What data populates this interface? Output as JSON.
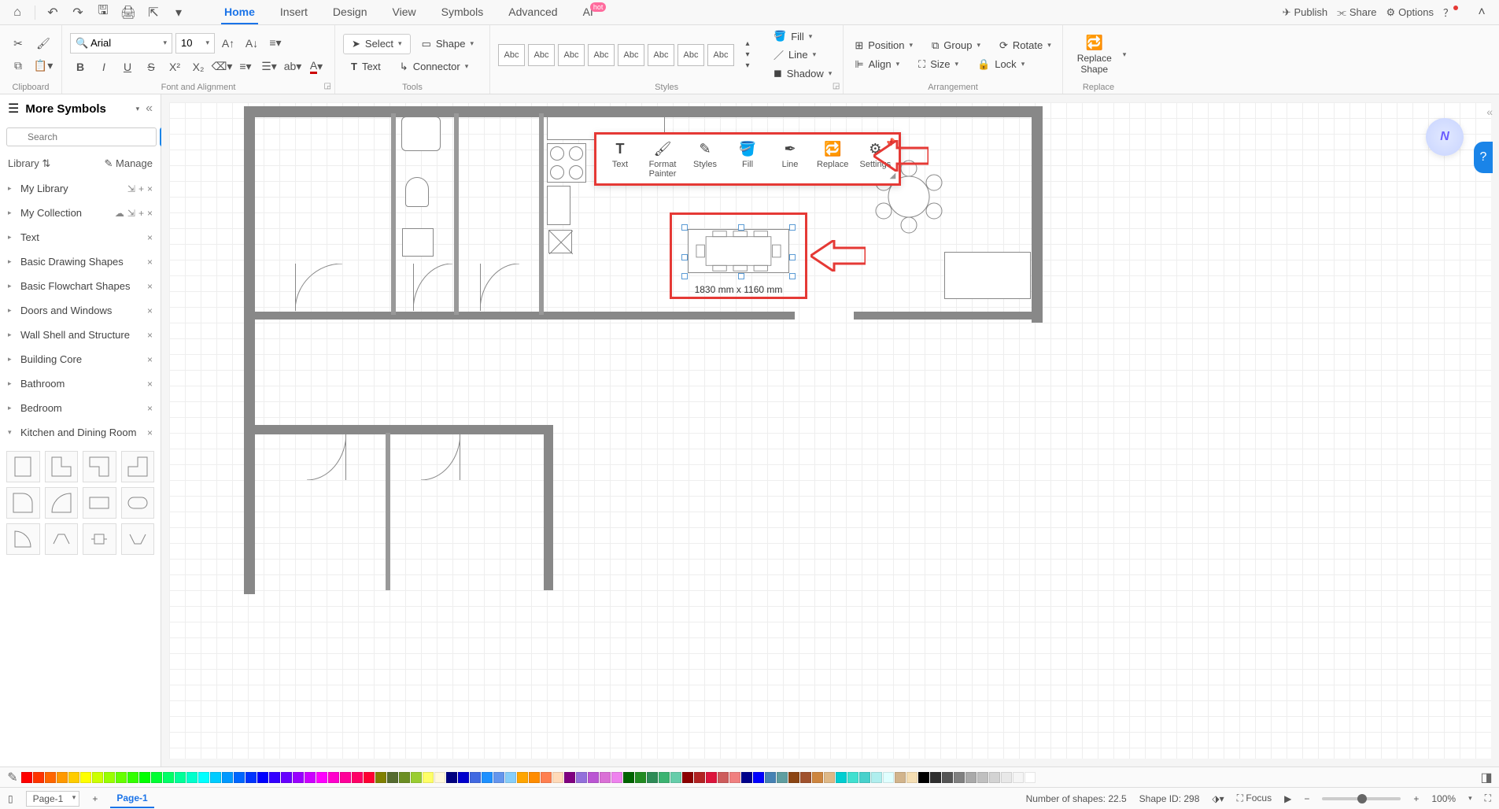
{
  "menubar": {
    "tabs": [
      "Home",
      "Insert",
      "Design",
      "View",
      "Symbols",
      "Advanced",
      "AI"
    ],
    "active_tab": "Home",
    "hot_label": "hot",
    "publish": "Publish",
    "share": "Share",
    "options": "Options"
  },
  "ribbon": {
    "clipboard_label": "Clipboard",
    "font_label": "Font and Alignment",
    "font_name": "Arial",
    "font_size": "10",
    "tools_label": "Tools",
    "select_label": "Select",
    "shape_label": "Shape",
    "text_label": "Text",
    "connector_label": "Connector",
    "styles_label": "Styles",
    "style_abc": "Abc",
    "fill_label": "Fill",
    "line_label": "Line",
    "shadow_label": "Shadow",
    "arrangement_label": "Arrangement",
    "position_label": "Position",
    "group_label": "Group",
    "rotate_label": "Rotate",
    "align_label": "Align",
    "size_label": "Size",
    "lock_label": "Lock",
    "replace_label": "Replace",
    "replace_shape_label": "Replace\nShape"
  },
  "sidebar": {
    "title": "More Symbols",
    "search_placeholder": "Search",
    "search_btn": "Search",
    "library_label": "Library",
    "manage_label": "Manage",
    "items": [
      {
        "label": "My Library",
        "actions": [
          "import",
          "add",
          "close"
        ]
      },
      {
        "label": "My Collection",
        "actions": [
          "cloud",
          "import",
          "add",
          "close"
        ]
      },
      {
        "label": "Text",
        "actions": [
          "close"
        ]
      },
      {
        "label": "Basic Drawing Shapes",
        "actions": [
          "close"
        ]
      },
      {
        "label": "Basic Flowchart Shapes",
        "actions": [
          "close"
        ]
      },
      {
        "label": "Doors and Windows",
        "actions": [
          "close"
        ]
      },
      {
        "label": "Wall Shell and Structure",
        "actions": [
          "close"
        ]
      },
      {
        "label": "Building Core",
        "actions": [
          "close"
        ]
      },
      {
        "label": "Bathroom",
        "actions": [
          "close"
        ]
      },
      {
        "label": "Bedroom",
        "actions": [
          "close"
        ]
      },
      {
        "label": "Kitchen and Dining Room",
        "actions": [
          "close"
        ],
        "expanded": true
      }
    ]
  },
  "float_toolbar": {
    "items": [
      {
        "label": "Text"
      },
      {
        "label": "Format\nPainter"
      },
      {
        "label": "Styles"
      },
      {
        "label": "Fill"
      },
      {
        "label": "Line"
      },
      {
        "label": "Replace"
      },
      {
        "label": "Settings"
      }
    ]
  },
  "selection": {
    "dimensions": "1830 mm x 1160 mm"
  },
  "status": {
    "page_select": "Page-1",
    "page_tab": "Page-1",
    "shape_count": "Number of shapes: 22.5",
    "shape_id": "Shape ID: 298",
    "focus": "Focus",
    "zoom": "100%"
  },
  "colors": [
    "#ff0000",
    "#ff3300",
    "#ff6600",
    "#ff9900",
    "#ffcc00",
    "#ffff00",
    "#ccff00",
    "#99ff00",
    "#66ff00",
    "#33ff00",
    "#00ff00",
    "#00ff33",
    "#00ff66",
    "#00ff99",
    "#00ffcc",
    "#00ffff",
    "#00ccff",
    "#0099ff",
    "#0066ff",
    "#0033ff",
    "#0000ff",
    "#3300ff",
    "#6600ff",
    "#9900ff",
    "#cc00ff",
    "#ff00ff",
    "#ff00cc",
    "#ff0099",
    "#ff0066",
    "#ff0033",
    "#808000",
    "#556b2f",
    "#6b8e23",
    "#9acd32",
    "#ffff66",
    "#fff8dc",
    "#000080",
    "#0000cd",
    "#4169e1",
    "#1e90ff",
    "#6495ed",
    "#87cefa",
    "#ffa500",
    "#ff8c00",
    "#ff7f50",
    "#ffdab9",
    "#800080",
    "#9370db",
    "#ba55d3",
    "#da70d6",
    "#ee82ee",
    "#006400",
    "#228b22",
    "#2e8b57",
    "#3cb371",
    "#66cdaa",
    "#8b0000",
    "#b22222",
    "#dc143c",
    "#cd5c5c",
    "#f08080",
    "#00008b",
    "#0000ff",
    "#4682b4",
    "#5f9ea0",
    "#8b4513",
    "#a0522d",
    "#cd853f",
    "#deb887",
    "#00ced1",
    "#40e0d0",
    "#48d1cc",
    "#afeeee",
    "#e0ffff",
    "#d2b48c",
    "#f5deb3",
    "#000000",
    "#2f2f2f",
    "#555555",
    "#808080",
    "#a9a9a9",
    "#c0c0c0",
    "#d3d3d3",
    "#e8e8e8",
    "#f5f5f5",
    "#ffffff"
  ]
}
